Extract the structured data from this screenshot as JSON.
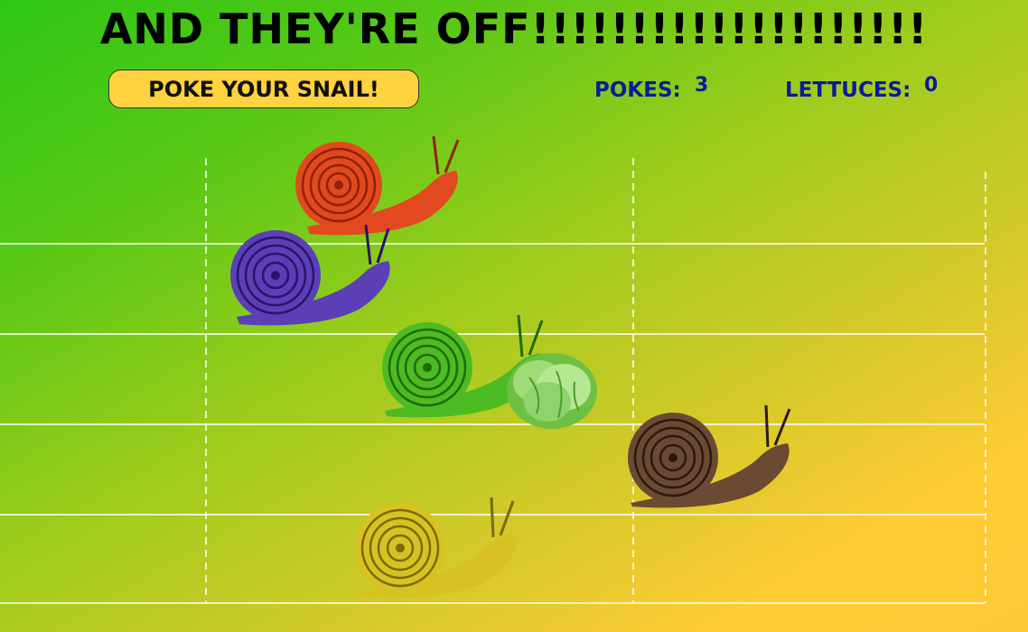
{
  "game": {
    "title": "AND THEY'RE OFF!!!!!!!!!!!!!!!!!!!!",
    "poke_button_label": "POKE YOUR SNAIL!",
    "stats": {
      "pokes_label": "POKES:",
      "pokes_value": "3",
      "lettuces_label": "LETTUCES:",
      "lettuces_value": "0"
    }
  },
  "racers": [
    {
      "id": "red",
      "icon": "snail-icon",
      "color": "#e2491f",
      "dark": "#8e230a"
    },
    {
      "id": "purple",
      "icon": "snail-icon",
      "color": "#5a3fb6",
      "dark": "#2a1468"
    },
    {
      "id": "green",
      "icon": "snail-icon",
      "color": "#4dbb22",
      "dark": "#1f6a0a"
    },
    {
      "id": "brown",
      "icon": "snail-icon",
      "color": "#6a4a33",
      "dark": "#2a1a0e"
    },
    {
      "id": "yellow",
      "icon": "snail-icon",
      "color": "#d8c222",
      "dark": "#7a6a08"
    }
  ],
  "pickups": [
    {
      "id": "lettuce",
      "icon": "lettuce-icon",
      "color": "#8ed46a"
    }
  ],
  "colors": {
    "lane_line": "#ffffff",
    "stat_text": "#0d1a9a",
    "button_fill": "#ffd23f"
  }
}
